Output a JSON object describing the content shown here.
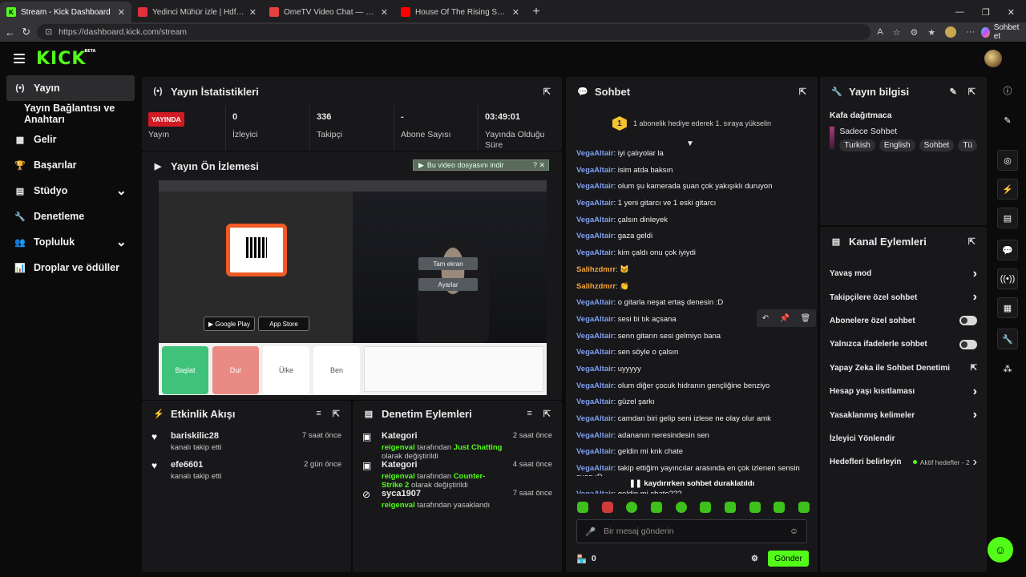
{
  "browser": {
    "tabs": [
      {
        "title": "Stream - Kick Dashboard",
        "fav": "K",
        "color": "#53fc18",
        "active": true
      },
      {
        "title": "Yedinci Mühür izle | Hdfilmcehenn",
        "fav": "",
        "color": "#e0303a",
        "active": false
      },
      {
        "title": "OmeTV Video Chat — Omegl",
        "fav": "",
        "color": "#e84040",
        "active": false
      },
      {
        "title": "House Of The Rising Sun - YouTub",
        "fav": "",
        "color": "#ff0000",
        "active": false
      }
    ],
    "url": "https://dashboard.kick.com/stream",
    "copilot_label": "Sohbet et"
  },
  "header": {
    "logo": "KICK",
    "logo_badge": "BETA"
  },
  "sidebar": {
    "items": [
      {
        "label": "Yayın",
        "icon": "(•)",
        "active": true
      },
      {
        "label": "Yayın Bağlantısı ve Anahtarı",
        "icon": "",
        "sub": true
      },
      {
        "label": "Gelir",
        "icon": "▦"
      },
      {
        "label": "Başarılar",
        "icon": "🏆"
      },
      {
        "label": "Stüdyo",
        "icon": "▤",
        "chev": true
      },
      {
        "label": "Denetleme",
        "icon": "🔧"
      },
      {
        "label": "Topluluk",
        "icon": "👥",
        "chev": true
      },
      {
        "label": "Droplar ve ödüller",
        "icon": "📊"
      }
    ]
  },
  "stats_panel": {
    "title": "Yayın İstatistikleri",
    "live_badge": "YAYINDA",
    "stats": [
      {
        "value": "",
        "label": "Yayın"
      },
      {
        "value": "0",
        "label": "İzleyici"
      },
      {
        "value": "336",
        "label": "Takipçi"
      },
      {
        "value": "-",
        "label": "Abone Sayısı"
      },
      {
        "value": "03:49:01",
        "label": "Yayında Olduğu Süre"
      }
    ]
  },
  "preview_panel": {
    "title": "Yayın Ön İzlemesi",
    "download_bar": "Bu video dosyasını indir",
    "overlay_fullscreen": "Tam ekran",
    "overlay_settings": "Ayarlar",
    "google_play": "Google Play",
    "app_store": "App Store",
    "cards": [
      "Başlat",
      "Dur",
      "Ülke",
      "Ben"
    ]
  },
  "activity_panel": {
    "title": "Etkinlik Akışı",
    "rows": [
      {
        "name": "bariskilic28",
        "desc": "kanalı takip etti",
        "time": "7 saat önce"
      },
      {
        "name": "efe6601",
        "desc": "kanalı takip etti",
        "time": "2 gün önce"
      }
    ]
  },
  "mod_panel": {
    "title": "Denetim Eylemleri",
    "rows": [
      {
        "name": "Kategori",
        "user": "reigenval",
        "mid": "tarafından",
        "target": "Just Chatting",
        "end": "olarak değiştirildi",
        "time": "2 saat önce"
      },
      {
        "name": "Kategori",
        "user": "reigenval",
        "mid": "tarafından",
        "target": "Counter-Strike 2",
        "end": "olarak değiştirildi",
        "time": "4 saat önce"
      },
      {
        "name": "syca1907",
        "user": "reigenval",
        "mid": "tarafından yasaklandı",
        "target": "",
        "end": "",
        "time": "7 saat önce"
      }
    ]
  },
  "chat_panel": {
    "title": "Sohbet",
    "gift_rank": "1",
    "gift_text": "1 abonelik hediye ederek 1. sıraya yükselin",
    "messages": [
      {
        "user": "VegaAltair",
        "text": "iyi çalıyolar la"
      },
      {
        "user": "VegaAltair",
        "text": "isim atda baksın"
      },
      {
        "user": "VegaAltair",
        "text": "olum şu kamerada şuan çok yakışıklı duruyon"
      },
      {
        "user": "VegaAltair",
        "text": "1 yeni gitarcı ve 1 eski gitarcı"
      },
      {
        "user": "VegaAltair",
        "text": "çalsın dinleyek"
      },
      {
        "user": "VegaAltair",
        "text": "gaza geldi"
      },
      {
        "user": "VegaAltair",
        "text": "kim çaldı onu çok iyiydi"
      },
      {
        "user": "Salihzdmrr",
        "text": "🐱",
        "orange": true
      },
      {
        "user": "Salihzdmrr",
        "text": "👏",
        "orange": true
      },
      {
        "user": "VegaAltair",
        "text": "o gitarla neşat ertaş denesin :D"
      },
      {
        "user": "VegaAltair",
        "text": "sesi bi tık açsana"
      },
      {
        "user": "VegaAltair",
        "text": "senn gitarın sesi gelmiyo bana"
      },
      {
        "user": "VegaAltair",
        "text": "sen söyle o çalsın"
      },
      {
        "user": "VegaAltair",
        "text": "uyyyyy"
      },
      {
        "user": "VegaAltair",
        "text": "olum diğer çocuk hidranın gençliğine benziyo"
      },
      {
        "user": "VegaAltair",
        "text": "güzel şarkı"
      },
      {
        "user": "VegaAltair",
        "text": "camdan biri gelip seni izlese ne olay olur amk"
      },
      {
        "user": "VegaAltair",
        "text": "adananın neresindesin sen"
      },
      {
        "user": "VegaAltair",
        "text": "geldin mi knk chate"
      },
      {
        "user": "VegaAltair",
        "text": "takip ettiğim yayıncılar arasında en çok izlenen sensin şuan :D",
        "tall": true
      },
      {
        "user": "VegaAltair",
        "text": "geldin mi chate???"
      }
    ],
    "pause_text": "kaydırırken sohbet duraklatıldı",
    "input_placeholder": "Bir mesaj gönderin",
    "points": "0",
    "send_label": "Gönder"
  },
  "info_panel": {
    "title": "Yayın bilgisi",
    "stream_title": "Kafa dağıtmaca",
    "category": "Sadece Sohbet",
    "tags": [
      "Turkish",
      "English",
      "Sohbet",
      "Tü"
    ]
  },
  "channel_actions": {
    "title": "Kanal Eylemleri",
    "rows": [
      {
        "label": "Yavaş mod",
        "kind": "chev"
      },
      {
        "label": "Takipçilere özel sohbet",
        "kind": "chev"
      },
      {
        "label": "Abonelere özel sohbet",
        "kind": "toggle"
      },
      {
        "label": "Yalnızca ifadelerle sohbet",
        "kind": "toggle"
      },
      {
        "label": "Yapay Zeka ile Sohbet Denetimi",
        "kind": "ext"
      },
      {
        "label": "Hesap yaşı kısıtlaması",
        "kind": "chev"
      },
      {
        "label": "Yasaklanmış kelimeler",
        "kind": "chev"
      },
      {
        "label": "İzleyici Yönlendir",
        "kind": "none"
      },
      {
        "label": "Hedefleri belirleyin",
        "kind": "goal"
      }
    ],
    "goal_status": "Aktif hedefler - 2"
  },
  "colors": {
    "brand": "#53fc18",
    "live": "#d01b24",
    "username": "#7f9fef"
  }
}
